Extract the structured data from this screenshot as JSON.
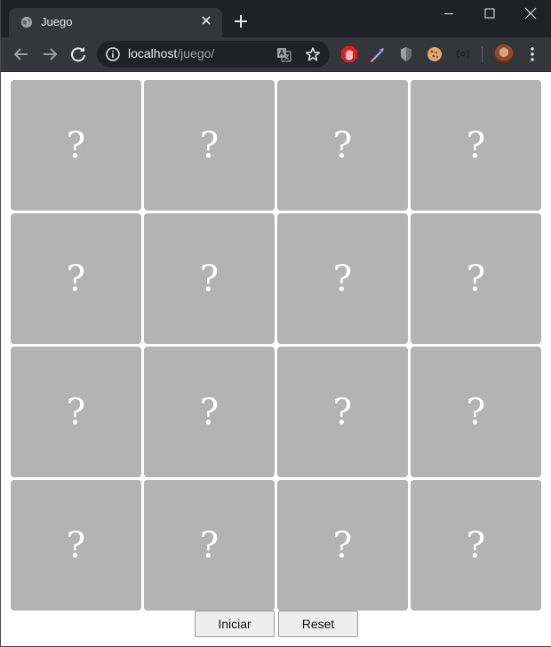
{
  "browser": {
    "tab_title": "Juego",
    "url_host": "localhost",
    "url_path": "/juego/"
  },
  "game": {
    "cards": [
      {
        "face": "?"
      },
      {
        "face": "?"
      },
      {
        "face": "?"
      },
      {
        "face": "?"
      },
      {
        "face": "?"
      },
      {
        "face": "?"
      },
      {
        "face": "?"
      },
      {
        "face": "?"
      },
      {
        "face": "?"
      },
      {
        "face": "?"
      },
      {
        "face": "?"
      },
      {
        "face": "?"
      },
      {
        "face": "?"
      },
      {
        "face": "?"
      },
      {
        "face": "?"
      },
      {
        "face": "?"
      }
    ],
    "card_color": "#b3b3b3",
    "start_label": "Iniciar",
    "reset_label": "Reset"
  }
}
